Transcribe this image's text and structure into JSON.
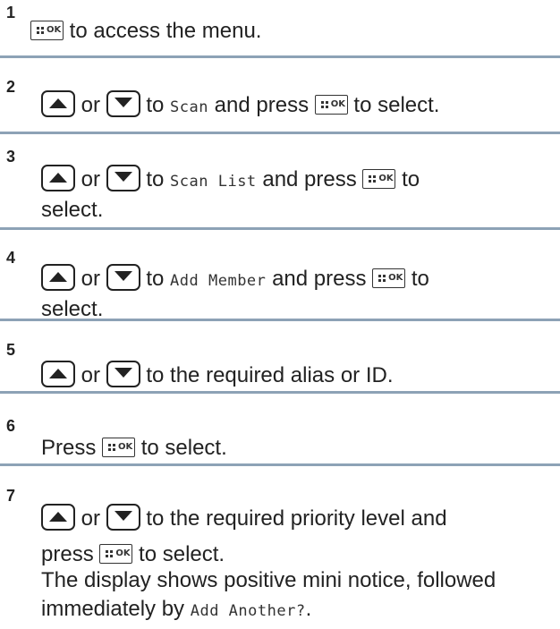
{
  "steps": [
    {
      "number": "1",
      "parts": {
        "t1": "to access the menu."
      }
    },
    {
      "number": "2",
      "parts": {
        "or": "or",
        "t1": "to",
        "m1": "Scan",
        "t2": "and press",
        "t3": "to select."
      }
    },
    {
      "number": "3",
      "parts": {
        "or": "or",
        "t1": "to",
        "m1": "Scan List",
        "t2": "and press",
        "t3": "to",
        "t4": "select."
      }
    },
    {
      "number": "4",
      "parts": {
        "or": "or",
        "t1": "to",
        "m1": "Add Member",
        "t2": "and press",
        "t3": "to",
        "t4": "select."
      }
    },
    {
      "number": "5",
      "parts": {
        "or": "or",
        "t1": "to the required alias or ID."
      }
    },
    {
      "number": "6",
      "parts": {
        "t0": "Press",
        "t1": "to select."
      }
    },
    {
      "number": "7",
      "parts": {
        "or": "or",
        "t1": "to the required priority level and",
        "t2": "press",
        "t3": "to select.",
        "t4": "The display shows positive mini notice, followed immediately by",
        "m1": "Add Another?",
        "t5": "."
      }
    }
  ],
  "icons": {
    "ok_key": "ok-key-icon",
    "up_key": "up-arrow-key-icon",
    "down_key": "down-arrow-key-icon"
  },
  "ok_key_label": "OK"
}
